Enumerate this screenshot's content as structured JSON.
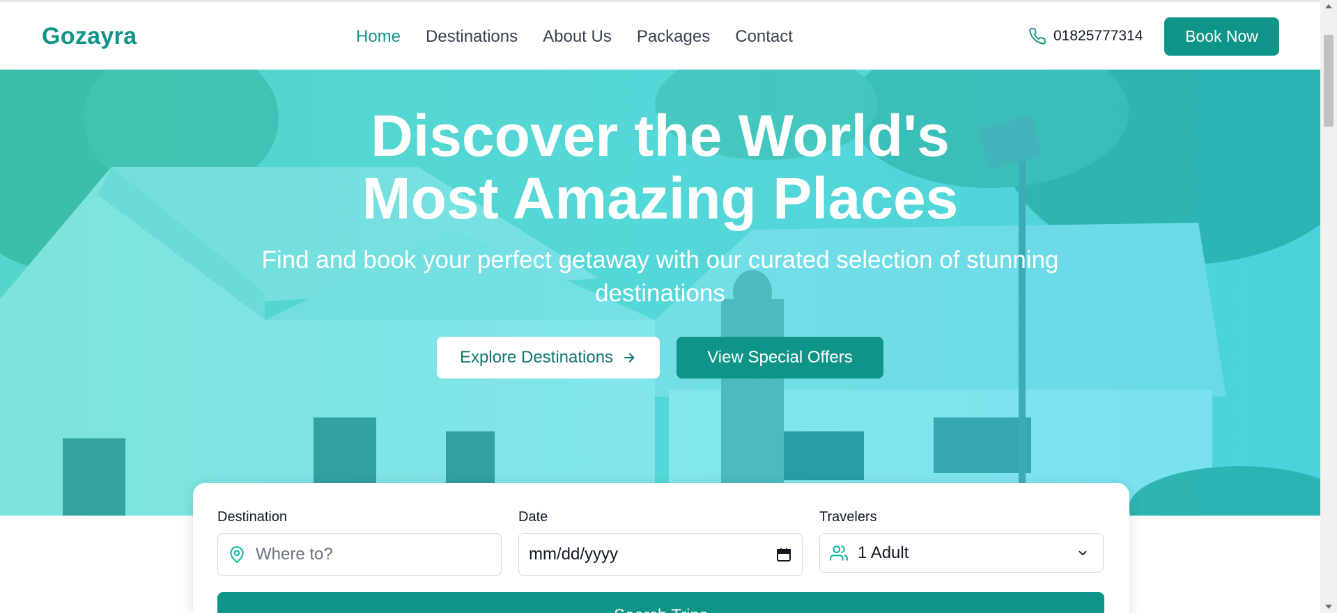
{
  "header": {
    "logo": "Gozayra",
    "nav": [
      {
        "label": "Home",
        "active": true
      },
      {
        "label": "Destinations",
        "active": false
      },
      {
        "label": "About Us",
        "active": false
      },
      {
        "label": "Packages",
        "active": false
      },
      {
        "label": "Contact",
        "active": false
      }
    ],
    "phone": "01825777314",
    "book_label": "Book Now"
  },
  "hero": {
    "title_line1": "Discover the World's",
    "title_line2": "Most Amazing Places",
    "subtitle": "Find and book your perfect getaway with our curated selection of stunning destinations",
    "explore_label": "Explore Destinations",
    "offers_label": "View Special Offers"
  },
  "search": {
    "destination_label": "Destination",
    "destination_placeholder": "Where to?",
    "date_label": "Date",
    "date_placeholder": "mm/dd/yyyy",
    "travelers_label": "Travelers",
    "travelers_value": "1 Adult",
    "search_label": "Search Trips"
  },
  "colors": {
    "brand": "#0f9488",
    "hero_tint": "#2bd4d8"
  }
}
